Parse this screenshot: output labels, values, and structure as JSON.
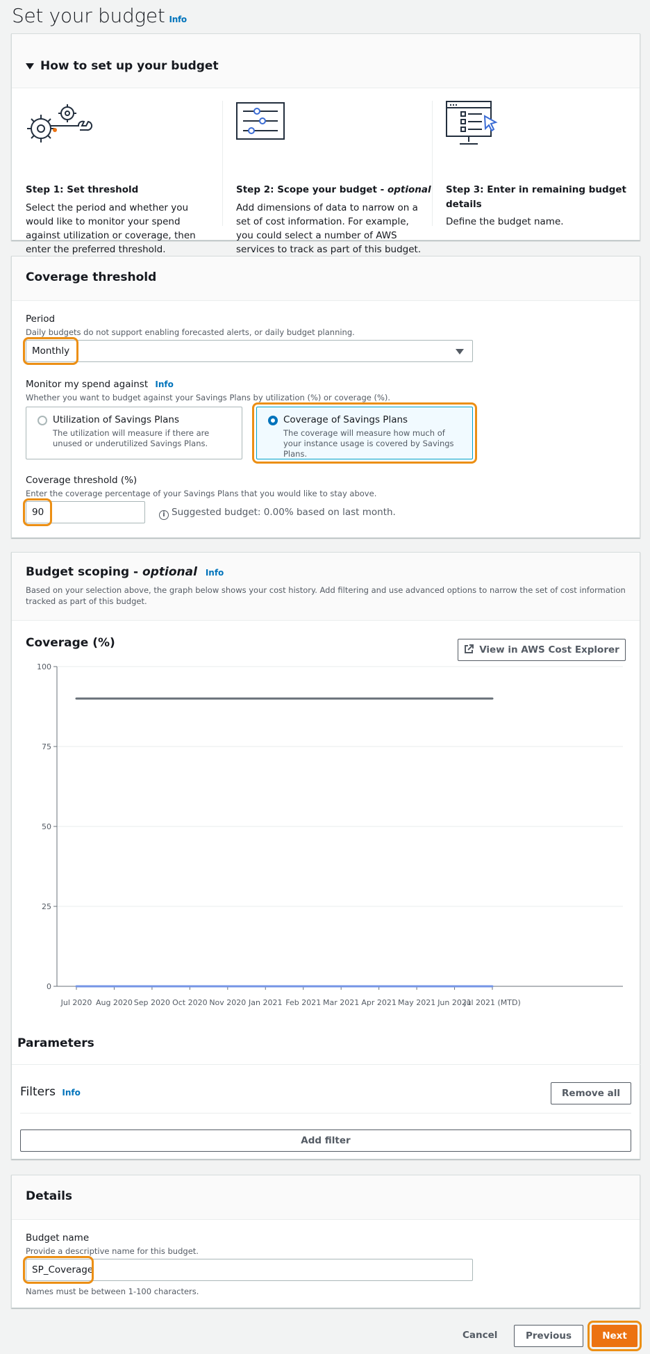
{
  "page": {
    "title": "Set your budget",
    "info": "Info"
  },
  "howto": {
    "title": "How to set up your budget",
    "steps": [
      {
        "title": "Step 1: Set threshold",
        "desc": "Select the period and whether you would like to monitor your spend against utilization or coverage, then enter the preferred threshold."
      },
      {
        "title": "Step 2: Scope your budget - ",
        "title_em": "optional",
        "desc": "Add dimensions of data to narrow on a set of cost information. For example, you could select a number of AWS services to track as part of this budget."
      },
      {
        "title": "Step 3: Enter in remaining budget details",
        "desc": "Define the budget name."
      }
    ]
  },
  "coverage": {
    "title": "Coverage threshold",
    "period_label": "Period",
    "period_desc": "Daily budgets do not support enabling forecasted alerts, or daily budget planning.",
    "period_value": "Monthly",
    "monitor_label": "Monitor my spend against",
    "monitor_info": "Info",
    "monitor_desc": "Whether you want to budget against your Savings Plans by utilization (%) or coverage (%).",
    "options": [
      {
        "title": "Utilization of Savings Plans",
        "desc": "The utilization will measure if there are unused or underutilized Savings Plans."
      },
      {
        "title": "Coverage of Savings Plans",
        "desc": "The coverage will measure how much of your instance usage is covered by Savings Plans."
      }
    ],
    "threshold_label": "Coverage threshold (%)",
    "threshold_desc": "Enter the coverage percentage of your Savings Plans that you would like to stay above.",
    "threshold_value": "90",
    "suggested": "Suggested budget: 0.00% based on last month."
  },
  "scoping": {
    "title": "Budget scoping - ",
    "title_em": "optional",
    "info": "Info",
    "desc": "Based on your selection above, the graph below shows your cost history. Add filtering and use advanced options to narrow the set of cost information tracked as part of this budget.",
    "chart_title": "Coverage (%)",
    "explorer_button": "View in AWS Cost Explorer",
    "params_title": "Parameters",
    "filters_title": "Filters",
    "filters_info": "Info",
    "remove_all": "Remove all",
    "add_filter": "Add filter"
  },
  "chart_data": {
    "type": "line",
    "title": "Coverage (%)",
    "ylim": [
      0,
      100
    ],
    "yticks": [
      0,
      25,
      50,
      75,
      100
    ],
    "categories": [
      "Jul 2020",
      "Aug 2020",
      "Sep 2020",
      "Oct 2020",
      "Nov 2020",
      "Jan 2021",
      "Feb 2021",
      "Mar 2021",
      "Apr 2021",
      "May 2021",
      "Jun 2021",
      "Jul 2021 (MTD)"
    ],
    "series": [
      {
        "values": [
          90,
          90,
          90,
          90,
          90,
          90,
          90,
          90,
          90,
          90,
          90,
          90
        ],
        "color": "#687078"
      },
      {
        "values": [
          0,
          0,
          0,
          0,
          0,
          0,
          0,
          0,
          0,
          0,
          0,
          0
        ],
        "color": "#7495e6"
      }
    ]
  },
  "details": {
    "title": "Details",
    "name_label": "Budget name",
    "name_desc": "Provide a descriptive name for this budget.",
    "name_value": "SP_Coverage",
    "name_hint": "Names must be between 1-100 characters."
  },
  "footer": {
    "cancel": "Cancel",
    "previous": "Previous",
    "next": "Next"
  },
  "colors": {
    "accent": "#ec7211",
    "highlight": "#ec8f14",
    "link": "#0073bb"
  }
}
